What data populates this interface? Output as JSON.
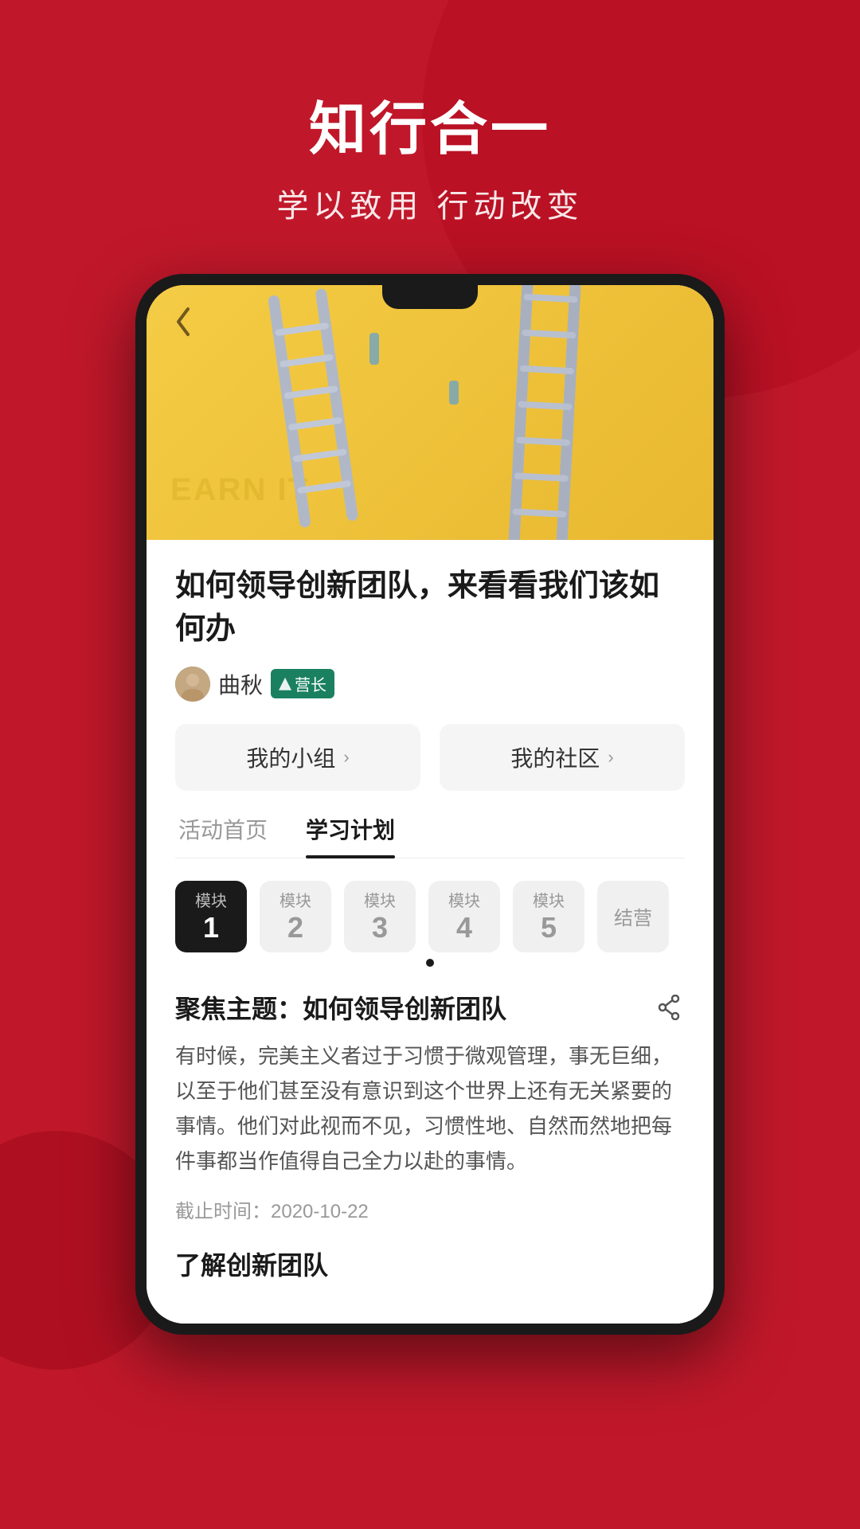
{
  "background": {
    "color": "#c0182a"
  },
  "header": {
    "main_title": "知行合一",
    "sub_title": "学以致用 行动改变"
  },
  "phone": {
    "hero": {
      "watermark": "EARN IT"
    },
    "back_button": "‹",
    "article": {
      "title": "如何领导创新团队，来看看我们该如何办",
      "author_name": "曲秋",
      "author_badge": "营长",
      "nav_buttons": [
        {
          "label": "我的小组",
          "chevron": "›"
        },
        {
          "label": "我的社区",
          "chevron": "›"
        }
      ],
      "tabs": [
        {
          "label": "活动首页",
          "active": false
        },
        {
          "label": "学习计划",
          "active": true
        }
      ],
      "modules": [
        {
          "top": "模块",
          "num": "1",
          "active": true
        },
        {
          "top": "模块",
          "num": "2",
          "active": false
        },
        {
          "top": "模块",
          "num": "3",
          "active": false
        },
        {
          "top": "模块",
          "num": "4",
          "active": false
        },
        {
          "top": "模块",
          "num": "5",
          "active": false
        },
        {
          "top": "",
          "num": "",
          "text": "结营",
          "active": false
        }
      ],
      "focus_title": "聚焦主题：如何领导创新团队",
      "focus_body": "有时候，完美主义者过于习惯于微观管理，事无巨细，以至于他们甚至没有意识到这个世界上还有无关紧要的事情。他们对此视而不见，习惯性地、自然而然地把每件事都当作值得自己全力以赴的事情。",
      "deadline": "截止时间：2020-10-22",
      "section_subtitle": "了解创新团队"
    }
  }
}
